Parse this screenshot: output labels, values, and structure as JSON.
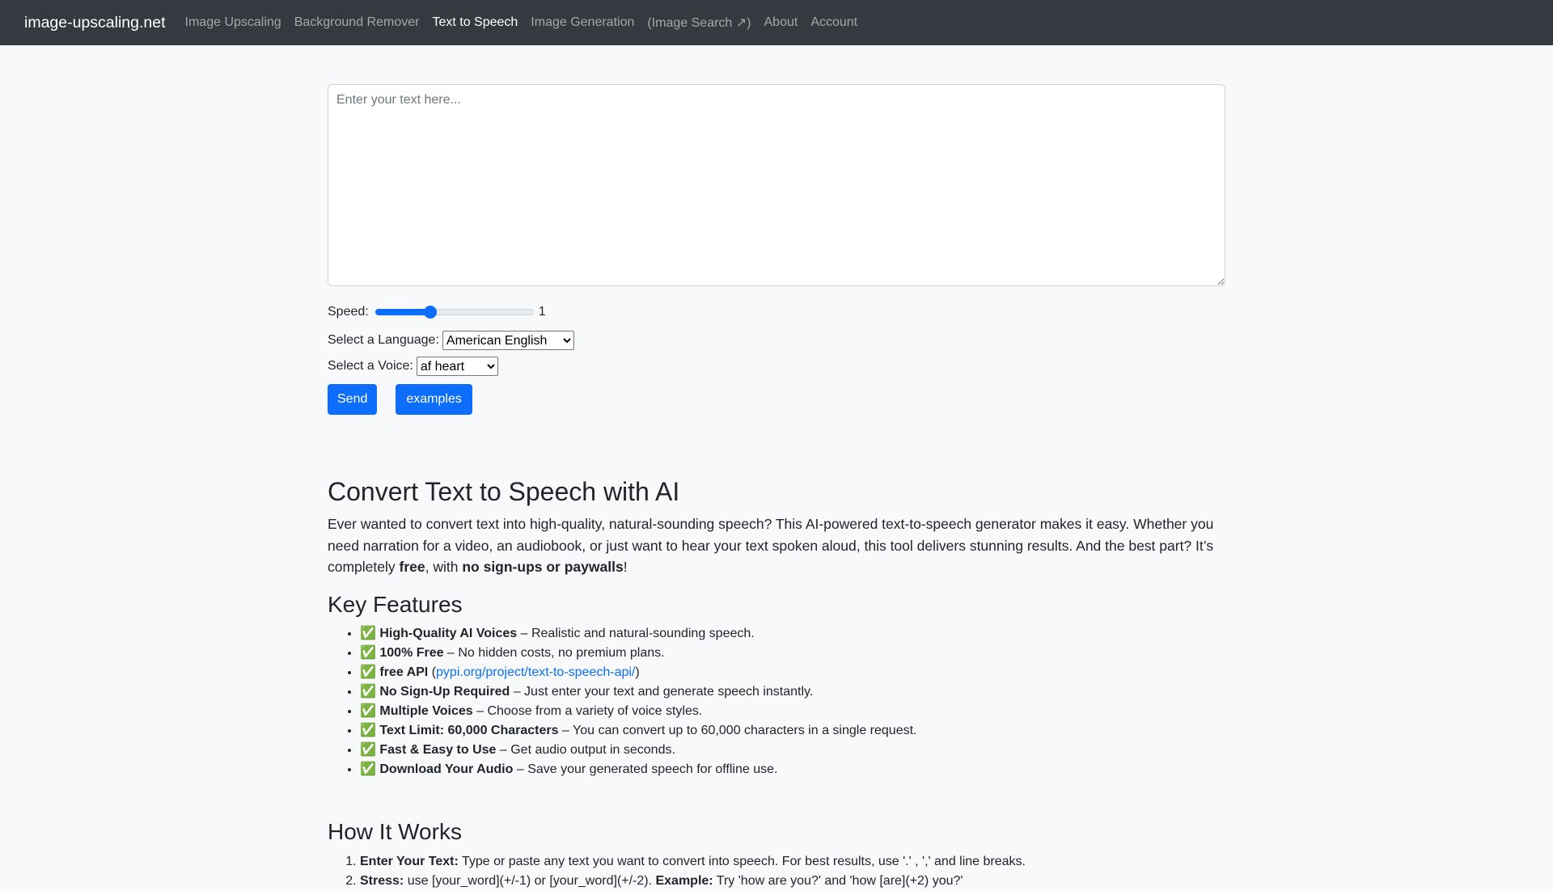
{
  "nav": {
    "brand": "image-upscaling.net",
    "links": [
      "Image Upscaling",
      "Background Remover",
      "Text to Speech",
      "Image Generation",
      "(Image Search ↗)",
      "About",
      "Account"
    ]
  },
  "textarea": {
    "placeholder": "Enter your text here..."
  },
  "controls": {
    "speed_label": "Speed:",
    "speed_value": "1",
    "speed_fraction": 0.35,
    "language_label": "Select a Language:",
    "language_selected": "American English",
    "voice_label": "Select a Voice:",
    "voice_selected": "af heart",
    "send_label": "Send",
    "examples_label": "examples"
  },
  "intro": {
    "heading": "Convert Text to Speech with AI",
    "text1": "Ever wanted to convert text into high-quality, natural-sounding speech? This AI-powered text-to-speech generator makes it easy. Whether you need narration for a video, an audiobook, or just want to hear your text spoken aloud, this tool delivers stunning results. And the best part? It’s completely ",
    "bold1": "free",
    "text2": ", with ",
    "bold2": "no sign-ups or paywalls",
    "text3": "!"
  },
  "features": {
    "heading": "Key Features",
    "check": "✅",
    "items": [
      {
        "title": "High-Quality AI Voices",
        "desc": " – Realistic and natural-sounding speech."
      },
      {
        "title": "100% Free",
        "desc": " – No hidden costs, no premium plans."
      },
      {
        "title": "free API",
        "pre": " (",
        "link": "pypi.org/project/text-to-speech-api/",
        "post": ")"
      },
      {
        "title": "No Sign-Up Required",
        "desc": " – Just enter your text and generate speech instantly."
      },
      {
        "title": "Multiple Voices",
        "desc": " – Choose from a variety of voice styles."
      },
      {
        "title": "Text Limit: 60,000 Characters",
        "desc": " – You can convert up to 60,000 characters in a single request."
      },
      {
        "title": "Fast & Easy to Use",
        "desc": " – Get audio output in seconds."
      },
      {
        "title": "Download Your Audio",
        "desc": " – Save your generated speech for offline use."
      }
    ]
  },
  "how": {
    "heading": "How It Works",
    "steps": [
      {
        "title": "Enter Your Text:",
        "desc": " Type or paste any text you want to convert into speech. For best results, use '.' , ',' and line breaks."
      },
      {
        "title": "Stress:",
        "desc": " use [your_word](+/-1) or [your_word](+/-2). ",
        "title2": "Example:",
        "desc2": " Try 'how are you?' and 'how [are](+2) you?'"
      }
    ]
  }
}
